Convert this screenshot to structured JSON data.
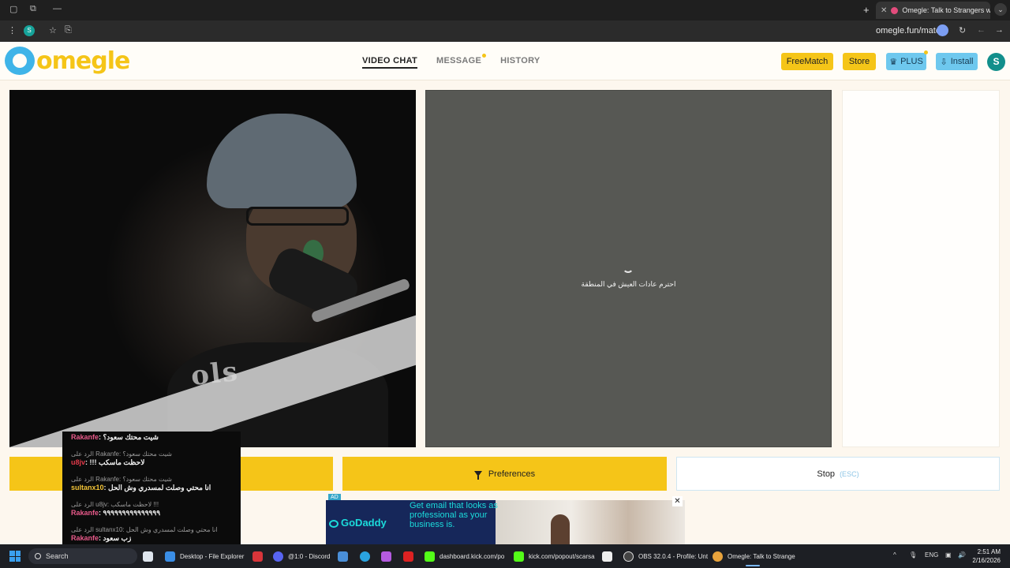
{
  "browser": {
    "tab_title": "Omegle: Talk to Strangers w",
    "new_tab": "+",
    "url": "omegle.fun/match",
    "profile_initial": "S"
  },
  "site": {
    "logo_text": "omegle",
    "nav": [
      {
        "label": "VIDEO CHAT",
        "active": true
      },
      {
        "label": "MESSAGE",
        "badge": true
      },
      {
        "label": "HISTORY"
      }
    ],
    "buttons": {
      "freematch": "FreeMatch",
      "store": "Store",
      "plus": "PLUS",
      "install": "Install"
    },
    "avatar_initial": "S"
  },
  "video": {
    "local_overlay_text": "ols",
    "remote_status": "احترم عادات العيش في المنطقة"
  },
  "controls": {
    "preferences": "Preferences",
    "stop": "Stop",
    "stop_hint": "(ESC)"
  },
  "ad": {
    "label": "AD",
    "brand": "GoDaddy",
    "headline": "Get email that looks as professional as your business is.",
    "close": "✕"
  },
  "chat": [
    {
      "type": "msg",
      "user": "Rakanfe",
      "user_color": "#e85a8a",
      "text": "شيت محتك سعود؟"
    },
    {
      "type": "reply",
      "text": "الرد على Rakanfe: شيت محتك سعود؟"
    },
    {
      "type": "msg",
      "user": "u8jv",
      "user_color": "#e23a4a",
      "text": "!!! لاحظت ماسكب"
    },
    {
      "type": "reply",
      "text": "الرد على Rakanfe: شيت محتك سعود؟"
    },
    {
      "type": "msg",
      "user": "sultanx10",
      "user_color": "#f3c437",
      "text": "انا محتي وصلت لمسدري وش الحل"
    },
    {
      "type": "reply",
      "text": "الرد على u8jv: لاحظت ماسكب !!!"
    },
    {
      "type": "msg",
      "user": "Rakanfe",
      "user_color": "#e85a8a",
      "text": "٩٩٩٩٩٩٩٩٩٩٩٩٩٩٩"
    },
    {
      "type": "reply",
      "text": "الرد على sultanx10: انا محتي وصلت لمسدري وش الحل"
    },
    {
      "type": "msg",
      "user": "Rakanfe",
      "user_color": "#e85a8a",
      "text": "زب سعود"
    }
  ],
  "taskbar": {
    "search": "Search",
    "apps": [
      {
        "label": "Desktop - File Explorer",
        "color": "#3a8ee6"
      },
      {
        "label": "@1:0 - Discord",
        "color": "#5865f2"
      },
      {
        "label": "dashboard.kick.com/po",
        "color": "#53fc18"
      },
      {
        "label": "kick.com/popout/scarsa",
        "color": "#53fc18"
      },
      {
        "label": "OBS 32.0.4 - Profile: Unt",
        "color": "#444"
      },
      {
        "label": "Omegle: Talk to Strange",
        "color": "#e8a33c",
        "active": true
      }
    ],
    "lang": "ENG",
    "time": "2:51 AM",
    "date": "2/16/2026"
  }
}
